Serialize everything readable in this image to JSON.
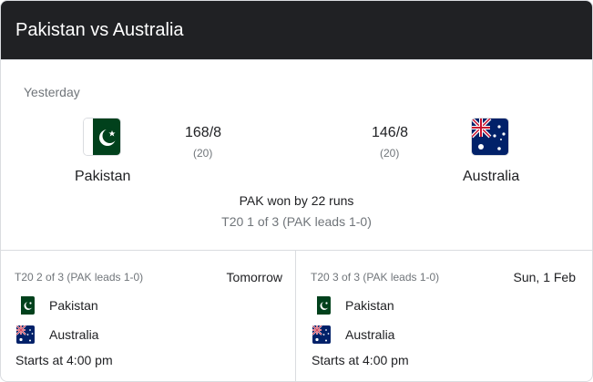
{
  "header": {
    "title": "Pakistan vs Australia"
  },
  "last_match": {
    "when": "Yesterday",
    "team1": {
      "name": "Pakistan",
      "score": "168/8",
      "overs": "(20)"
    },
    "team2": {
      "name": "Australia",
      "score": "146/8",
      "overs": "(20)"
    },
    "result": "PAK won by 22 runs",
    "series": "T20 1 of 3 (PAK leads 1-0)"
  },
  "fixtures": [
    {
      "series": "T20 2 of 3 (PAK leads 1-0)",
      "date": "Tomorrow",
      "team1": "Pakistan",
      "team2": "Australia",
      "start": "Starts at 4:00 pm"
    },
    {
      "series": "T20 3 of 3 (PAK leads 1-0)",
      "date": "Sun, 1 Feb",
      "team1": "Pakistan",
      "team2": "Australia",
      "start": "Starts at 4:00 pm"
    }
  ],
  "icons": {
    "team1_flag": "pakistan-flag-icon",
    "team2_flag": "australia-flag-icon"
  },
  "colors": {
    "header_bg": "#202124",
    "pakistan_green": "#01411c",
    "australia_blue": "#012169"
  }
}
